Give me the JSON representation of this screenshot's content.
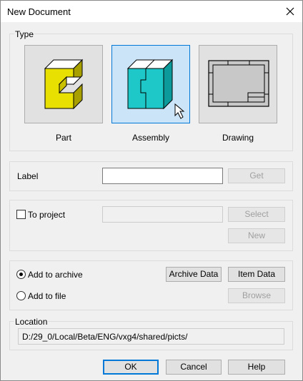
{
  "window": {
    "title": "New Document"
  },
  "type_group": {
    "label": "Type",
    "tiles": [
      {
        "label": "Part",
        "selected": false,
        "icon": "part-icon"
      },
      {
        "label": "Assembly",
        "selected": true,
        "icon": "assembly-icon"
      },
      {
        "label": "Drawing",
        "selected": false,
        "icon": "drawing-icon"
      }
    ]
  },
  "label_group": {
    "label": "Label",
    "value": "",
    "get_button": "Get"
  },
  "project_group": {
    "checkbox_label": "To project",
    "checked": false,
    "value": "",
    "select_button": "Select",
    "new_button": "New"
  },
  "archive_group": {
    "add_to_archive": "Add to archive",
    "add_to_file": "Add to file",
    "selected": "add_to_archive",
    "archive_data_button": "Archive Data",
    "item_data_button": "Item Data",
    "browse_button": "Browse"
  },
  "location_group": {
    "label": "Location",
    "value": "D:/29_0/Local/Beta/ENG/vxg4/shared/picts/"
  },
  "footer": {
    "ok": "OK",
    "cancel": "Cancel",
    "help": "Help"
  },
  "colors": {
    "part_yellow": "#e8e000",
    "assembly_teal": "#1ec8c8",
    "selection_blue": "#cce4f7",
    "accent": "#0078d7"
  }
}
